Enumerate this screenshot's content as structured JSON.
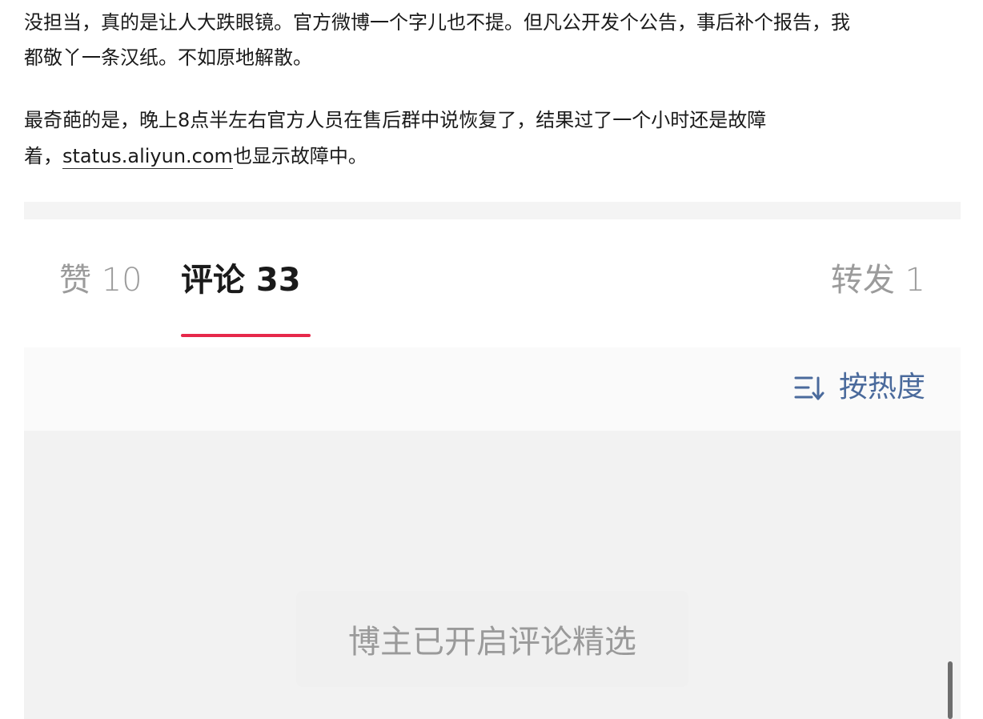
{
  "post": {
    "paragraph1": {
      "line1": "没担当，真的是让人大跌眼镜。官方微博一个字儿也不提。但凡公开发个公告，事后补个报告，我",
      "line2": "都敬丫一条汉纸。不如原地解散。"
    },
    "paragraph2": {
      "line1": "最奇葩的是，晚上8点半左右官方人员在售后群中说恢复了，结果过了一个小时还是故障",
      "line2_prefix": "着，",
      "link_text": "status.aliyun.com",
      "line2_suffix": "也显示故障中。"
    }
  },
  "tabs": {
    "likes_label": "赞 10",
    "comments_label": "评论 33",
    "reposts_label": "转发 1",
    "active": "comments",
    "accent_color": "#e6284a"
  },
  "sort": {
    "icon": "sort-icon",
    "label": "按热度",
    "color": "#4a6a9c"
  },
  "comments": {
    "notice": "博主已开启评论精选"
  }
}
